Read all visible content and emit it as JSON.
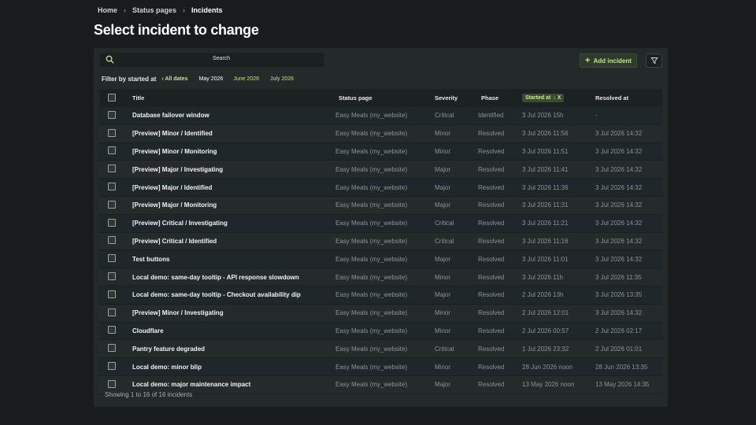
{
  "breadcrumb": [
    "Home",
    "Status pages",
    "Incidents"
  ],
  "page_title": "Select incident to change",
  "search": {
    "button_label": "Search",
    "placeholder": ""
  },
  "add_button": "Add incident",
  "filter": {
    "label": "Filter by started at",
    "all_dates": "‹ All dates",
    "current": "May 2026",
    "options": [
      "June 2026",
      "July 2026"
    ]
  },
  "columns": {
    "title": "Title",
    "status_page": "Status page",
    "severity": "Severity",
    "phase": "Phase",
    "started_at": "Started at",
    "resolved_at": "Resolved at"
  },
  "sort_indicator": "↓ X",
  "rows": [
    {
      "title": "Database failover window",
      "status_page": "Easy Meals (my_website)",
      "severity": "Critical",
      "phase": "Identified",
      "started_at": "3 Jul 2026 15h",
      "resolved_at": "-"
    },
    {
      "title": "[Preview] Minor / Identified",
      "status_page": "Easy Meals (my_website)",
      "severity": "Minor",
      "phase": "Resolved",
      "started_at": "3 Jul 2026 11:56",
      "resolved_at": "3 Jul 2026 14:32"
    },
    {
      "title": "[Preview] Minor / Monitoring",
      "status_page": "Easy Meals (my_website)",
      "severity": "Minor",
      "phase": "Resolved",
      "started_at": "3 Jul 2026 11:51",
      "resolved_at": "3 Jul 2026 14:32"
    },
    {
      "title": "[Preview] Major / Investigating",
      "status_page": "Easy Meals (my_website)",
      "severity": "Major",
      "phase": "Resolved",
      "started_at": "3 Jul 2026 11:41",
      "resolved_at": "3 Jul 2026 14:32"
    },
    {
      "title": "[Preview] Major / Identified",
      "status_page": "Easy Meals (my_website)",
      "severity": "Major",
      "phase": "Resolved",
      "started_at": "3 Jul 2026 11:36",
      "resolved_at": "3 Jul 2026 14:32"
    },
    {
      "title": "[Preview] Major / Monitoring",
      "status_page": "Easy Meals (my_website)",
      "severity": "Major",
      "phase": "Resolved",
      "started_at": "3 Jul 2026 11:31",
      "resolved_at": "3 Jul 2026 14:32"
    },
    {
      "title": "[Preview] Critical / Investigating",
      "status_page": "Easy Meals (my_website)",
      "severity": "Critical",
      "phase": "Resolved",
      "started_at": "3 Jul 2026 11:21",
      "resolved_at": "3 Jul 2026 14:32"
    },
    {
      "title": "[Preview] Critical / Identified",
      "status_page": "Easy Meals (my_website)",
      "severity": "Critical",
      "phase": "Resolved",
      "started_at": "3 Jul 2026 11:16",
      "resolved_at": "3 Jul 2026 14:32"
    },
    {
      "title": "Test buttons",
      "status_page": "Easy Meals (my_website)",
      "severity": "Major",
      "phase": "Resolved",
      "started_at": "3 Jul 2026 11:01",
      "resolved_at": "3 Jul 2026 14:32"
    },
    {
      "title": "Local demo: same-day tooltip - API response slowdown",
      "status_page": "Easy Meals (my_website)",
      "severity": "Minor",
      "phase": "Resolved",
      "started_at": "3 Jul 2026 11h",
      "resolved_at": "3 Jul 2026 11:35"
    },
    {
      "title": "Local demo: same-day tooltip - Checkout availability dip",
      "status_page": "Easy Meals (my_website)",
      "severity": "Major",
      "phase": "Resolved",
      "started_at": "2 Jul 2026 13h",
      "resolved_at": "3 Jul 2026 13:35"
    },
    {
      "title": "[Preview] Minor / Investigating",
      "status_page": "Easy Meals (my_website)",
      "severity": "Minor",
      "phase": "Resolved",
      "started_at": "2 Jul 2026 12:01",
      "resolved_at": "3 Jul 2026 14:32"
    },
    {
      "title": "Cloudflare",
      "status_page": "Easy Meals (my_website)",
      "severity": "Minor",
      "phase": "Resolved",
      "started_at": "2 Jul 2026 00:57",
      "resolved_at": "2 Jul 2026 02:17"
    },
    {
      "title": "Pantry feature degraded",
      "status_page": "Easy Meals (my_website)",
      "severity": "Critical",
      "phase": "Resolved",
      "started_at": "1 Jul 2026 23:32",
      "resolved_at": "2 Jul 2026 01:01"
    },
    {
      "title": "Local demo: minor blip",
      "status_page": "Easy Meals (my_website)",
      "severity": "Minor",
      "phase": "Resolved",
      "started_at": "28 Jun 2026 noon",
      "resolved_at": "28 Jun 2026 13:35"
    },
    {
      "title": "Local demo: major maintenance impact",
      "status_page": "Easy Meals (my_website)",
      "severity": "Major",
      "phase": "Resolved",
      "started_at": "13 May 2026 noon",
      "resolved_at": "13 May 2026 14:35"
    }
  ],
  "footer": "Showing 1 to 16 of 16 incidents",
  "colors": {
    "background": "#181c1c",
    "panel": "#232a29",
    "accent": "#bfe585"
  }
}
